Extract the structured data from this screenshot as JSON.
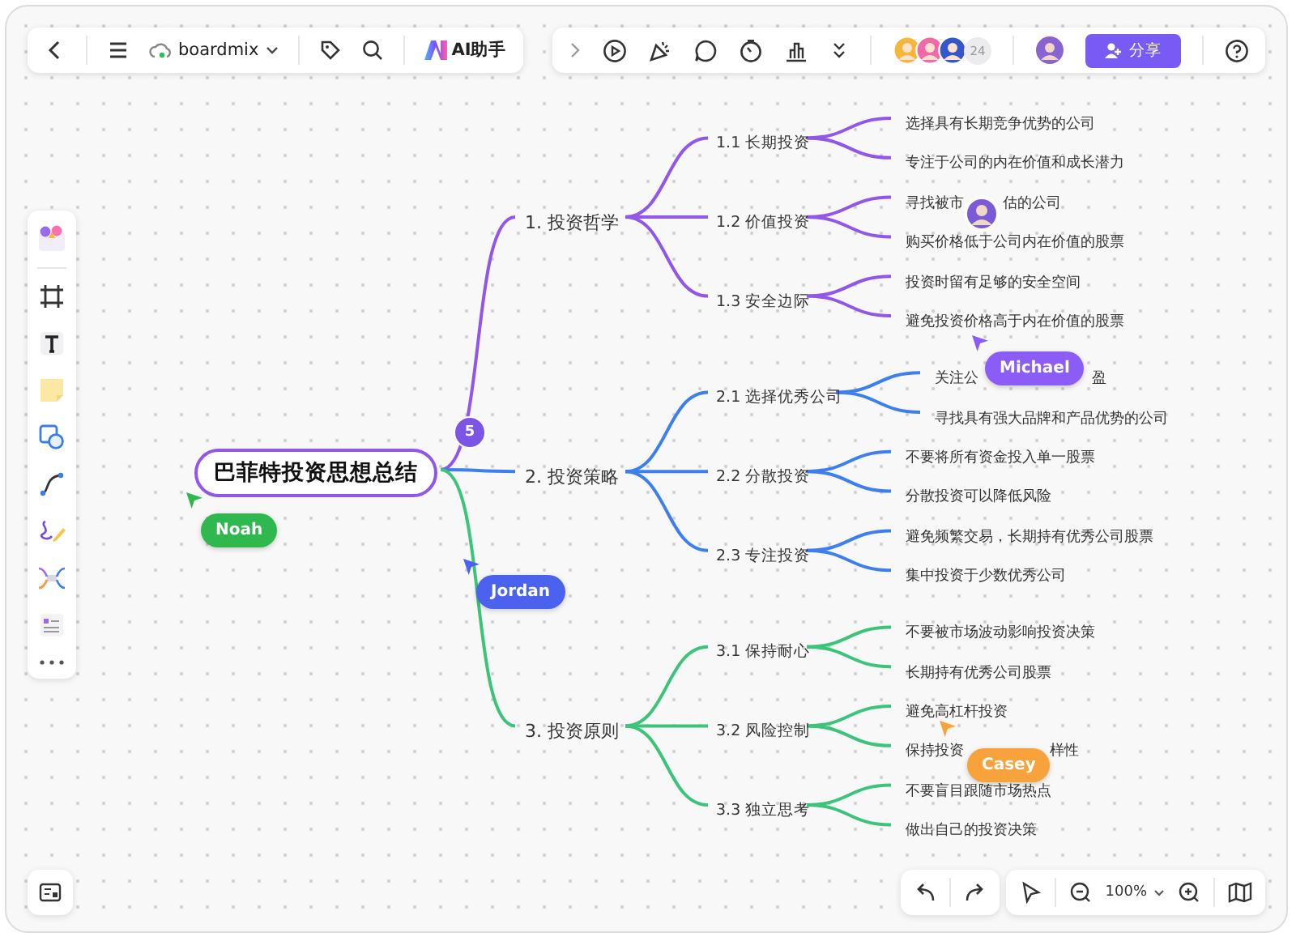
{
  "top_toolbar": {
    "file_name": "boardmix",
    "ai_button": "AI助手"
  },
  "collaborators": {
    "avatars": [
      {
        "color": "#f4b73a"
      },
      {
        "color": "#f06aa8"
      },
      {
        "color": "#3557c9"
      }
    ],
    "more_count": "24"
  },
  "share_button": "分享",
  "zoom": {
    "value": "100%"
  },
  "mind_map": {
    "root": "巴菲特投资思想总结",
    "collapsed_count": "5",
    "branches": [
      {
        "label": "1. 投资哲学",
        "color": "#9156ea",
        "children": [
          {
            "label": "1.1 长期投资",
            "children": [
              {
                "label": "选择具有长期竞争优势的公司"
              },
              {
                "label": "专注于公司的内在价值和成长潜力"
              }
            ]
          },
          {
            "label": "1.2 价值投资",
            "children": [
              {
                "parts": [
                  "寻找被市",
                  "估的公司"
                ]
              },
              {
                "label": "购买价格低于公司内在价值的股票"
              }
            ]
          },
          {
            "label": "1.3 安全边际",
            "children": [
              {
                "label": "投资时留有足够的安全空间"
              },
              {
                "label": "避免投资价格高于内在价值的股票"
              }
            ]
          }
        ]
      },
      {
        "label": "2. 投资策略",
        "color": "#3d7ff0",
        "children": [
          {
            "label": "2.1 选择优秀公司",
            "children": [
              {
                "parts": [
                  "关注公",
                  "盈"
                ]
              },
              {
                "label": "寻找具有强大品牌和产品优势的公司"
              }
            ]
          },
          {
            "label": "2.2 分散投资",
            "children": [
              {
                "label": "不要将所有资金投入单一股票"
              },
              {
                "label": "分散投资可以降低风险"
              }
            ]
          },
          {
            "label": "2.3 专注投资",
            "children": [
              {
                "label": "避免频繁交易，长期持有优秀公司股票"
              },
              {
                "label": "集中投资于少数优秀公司"
              }
            ]
          }
        ]
      },
      {
        "label": "3. 投资原则",
        "color": "#3cc47a",
        "children": [
          {
            "label": "3.1 保持耐心",
            "children": [
              {
                "label": "不要被市场波动影响投资决策"
              },
              {
                "label": "长期持有优秀公司股票"
              }
            ]
          },
          {
            "label": "3.2 风险控制",
            "children": [
              {
                "label": "避免高杠杆投资"
              },
              {
                "parts": [
                  "保持投资",
                  "样性"
                ]
              }
            ]
          },
          {
            "label": "3.3 独立思考",
            "children": [
              {
                "label": "不要盲目跟随市场热点"
              },
              {
                "label": "做出自己的投资决策"
              }
            ]
          }
        ]
      }
    ]
  },
  "cursors": [
    {
      "name": "Noah",
      "color": "#2eb84e"
    },
    {
      "name": "Jordan",
      "color": "#4a62ee"
    },
    {
      "name": "Michael",
      "color": "#8b5cf6"
    },
    {
      "name": "Casey",
      "color": "#f7a23b"
    }
  ]
}
